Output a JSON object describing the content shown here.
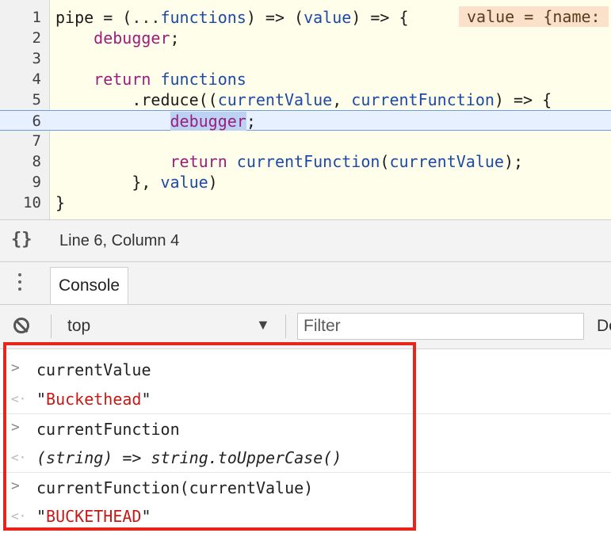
{
  "editor": {
    "lines": [
      {
        "num": "1"
      },
      {
        "num": "2"
      },
      {
        "num": "3"
      },
      {
        "num": "4"
      },
      {
        "num": "5"
      },
      {
        "num": "6"
      },
      {
        "num": "7"
      },
      {
        "num": "8"
      },
      {
        "num": "9"
      },
      {
        "num": "10"
      }
    ],
    "tokens": {
      "l1_pipe": "pipe",
      "l1_eq": " = (",
      "l1_spread": "...",
      "l1_functions": "functions",
      "l1_mid": ") => (",
      "l1_value": "value",
      "l1_end": ") => {",
      "l2_debugger": "debugger",
      "l2_semi": ";",
      "l4_return": "return",
      "l4_functions": "functions",
      "l5_reduce": ".reduce((",
      "l5_cv": "currentValue",
      "l5_comma": ", ",
      "l5_cf": "currentFunction",
      "l5_end": ") => {",
      "l6_debugger": "debugger",
      "l6_semi": ";",
      "l8_return": "return",
      "l8_cf": "currentFunction",
      "l8_paren": "(",
      "l8_cv": "currentValue",
      "l8_end": ");",
      "l9_close": "}, ",
      "l9_value": "value",
      "l9_paren": ")",
      "l10_close": "}"
    },
    "inline_value": "value = {name:"
  },
  "statusbar": {
    "braces_icon": "{}",
    "cursor_position": "Line 6, Column 4"
  },
  "drawer": {
    "more_icon": "vertical-ellipsis",
    "console_tab": "Console"
  },
  "console_toolbar": {
    "context": "top",
    "context_arrow": "▼",
    "filter_placeholder": "Filter",
    "levels": "De"
  },
  "console": {
    "m1_input": "currentValue",
    "m1_q1": "\"",
    "m1_result": "Buckethead",
    "m1_q2": "\"",
    "m2_input": "currentFunction",
    "m2_result_a": "(string)",
    "m2_result_b": " => ",
    "m2_result_c": "string.toUpperCase()",
    "m3_input": "currentFunction(currentValue)",
    "m3_q1": "\"",
    "m3_result": "BUCKETHEAD",
    "m3_q2": "\"",
    "input_arrow": ">",
    "result_arrow": "<·"
  },
  "colors": {
    "highlight_border": "#e8241b",
    "string": "#c41a16",
    "keyword": "#9b1e7a",
    "variable": "#1c4aa6"
  }
}
